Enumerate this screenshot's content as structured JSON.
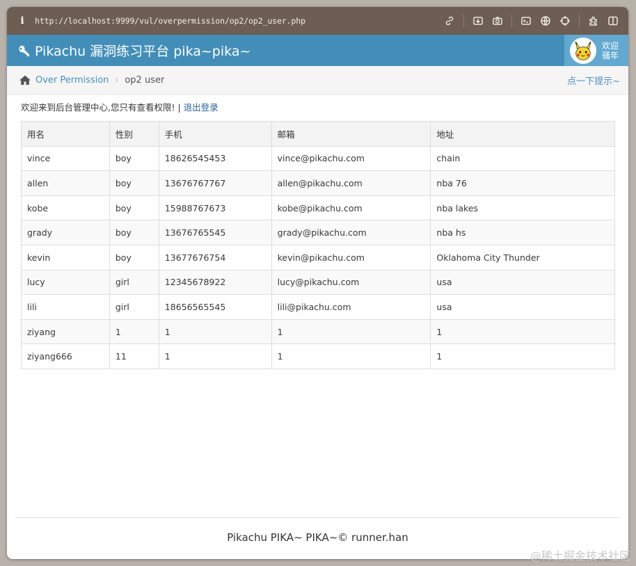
{
  "browser": {
    "url": "http://localhost:9999/vul/overpermission/op2/op2_user.php",
    "info_glyph": "i"
  },
  "navbar": {
    "brand": "Pikachu 漏洞练习平台 pika~pika~",
    "user_line1": "欢迎",
    "user_line2": "骚年"
  },
  "breadcrumbs": {
    "parent": "Over Permission",
    "current": "op2 user",
    "hint": "点一下提示~"
  },
  "content": {
    "welcome": "欢迎来到后台管理中心,您只有查看权限! | ",
    "logout": "退出登录"
  },
  "table": {
    "headers": [
      "用名",
      "性别",
      "手机",
      "邮箱",
      "地址"
    ],
    "rows": [
      [
        "vince",
        "boy",
        "18626545453",
        "vince@pikachu.com",
        "chain"
      ],
      [
        "allen",
        "boy",
        "13676767767",
        "allen@pikachu.com",
        "nba 76"
      ],
      [
        "kobe",
        "boy",
        "15988767673",
        "kobe@pikachu.com",
        "nba lakes"
      ],
      [
        "grady",
        "boy",
        "13676765545",
        "grady@pikachu.com",
        "nba hs"
      ],
      [
        "kevin",
        "boy",
        "13677676754",
        "kevin@pikachu.com",
        "Oklahoma City Thunder"
      ],
      [
        "lucy",
        "girl",
        "12345678922",
        "lucy@pikachu.com",
        "usa"
      ],
      [
        "lili",
        "girl",
        "18656565545",
        "lili@pikachu.com",
        "usa"
      ],
      [
        "ziyang",
        "1",
        "1",
        "1",
        "1"
      ],
      [
        "ziyang666",
        "11",
        "1",
        "1",
        "1"
      ]
    ]
  },
  "footer": {
    "text": "Pikachu PIKA~ PIKA~© runner.han"
  },
  "watermark": "@稀土掘金技术社区",
  "colors": {
    "browser_bar": "#6d5d52",
    "navbar": "#438eb9",
    "user_box": "#62a8d1",
    "link": "#4c8fbd"
  }
}
